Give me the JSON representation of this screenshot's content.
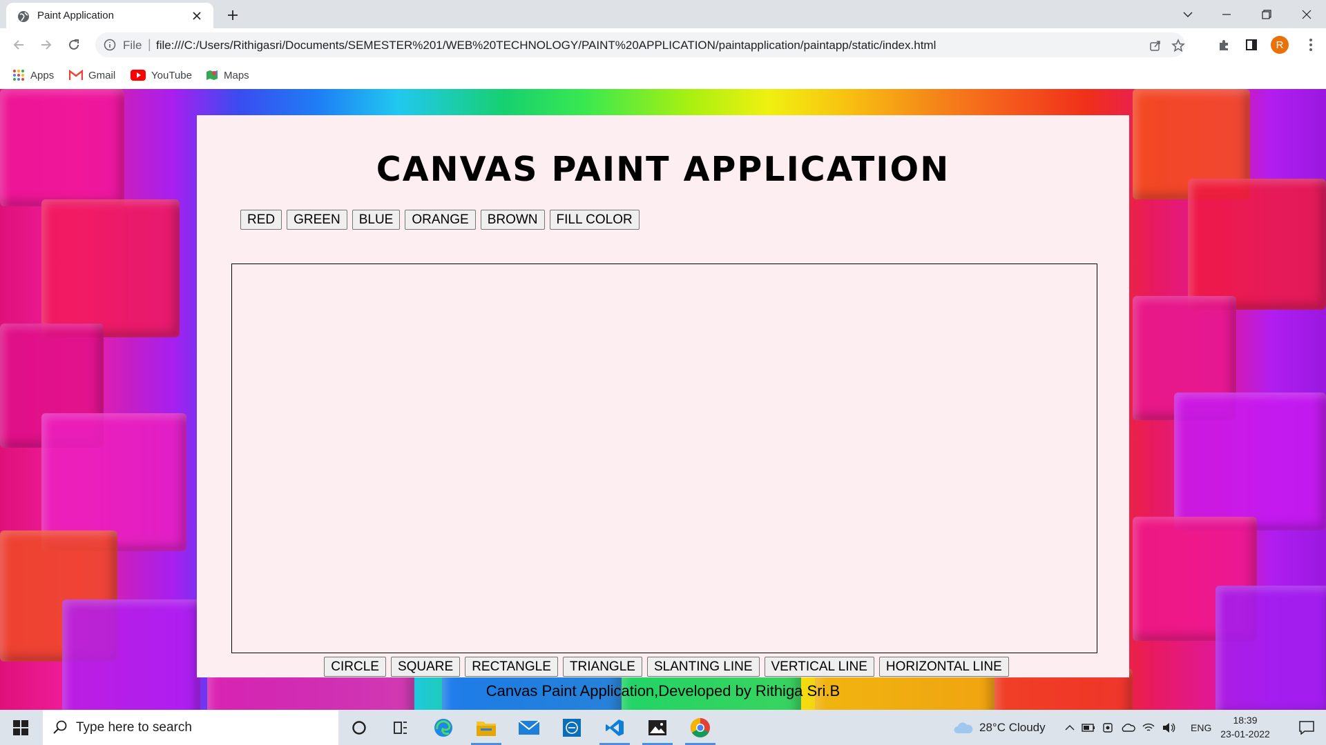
{
  "browser": {
    "tab_title": "Paint Application",
    "address_scheme": "File",
    "address_url": "file:///C:/Users/Rithigasri/Documents/SEMESTER%201/WEB%20TECHNOLOGY/PAINT%20APPLICATION/paintapplication/paintapp/static/index.html",
    "profile_initial": "R",
    "bookmarks": [
      "Apps",
      "Gmail",
      "YouTube",
      "Maps"
    ]
  },
  "app": {
    "title": "CANVAS PAINT APPLICATION",
    "color_buttons": [
      "RED",
      "GREEN",
      "BLUE",
      "ORANGE",
      "BROWN",
      "FILL COLOR"
    ],
    "shape_buttons": [
      "CIRCLE",
      "SQUARE",
      "RECTANGLE",
      "TRIANGLE",
      "SLANTING LINE",
      "VERTICAL LINE",
      "HORIZONTAL LINE"
    ],
    "footer": "Canvas Paint Application,Developed by Rithiga Sri.B"
  },
  "taskbar": {
    "search_placeholder": "Type here to search",
    "weather": "28°C  Cloudy",
    "language": "ENG",
    "time": "18:39",
    "date": "23-01-2022"
  },
  "colors": {
    "page_panel": "#fdeef2",
    "button_bg": "#efefef",
    "taskbar_bg": "#dde3ea",
    "chrome_bg": "#dee1e6"
  }
}
